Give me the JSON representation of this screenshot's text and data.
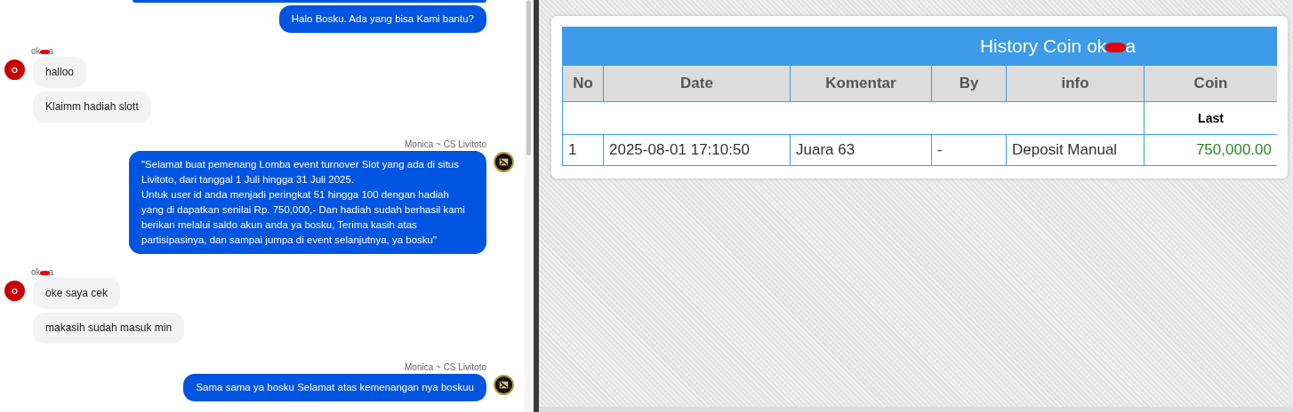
{
  "chat": {
    "groups": [
      {
        "kind": "agent",
        "avatar": false,
        "bubbles": [
          "Halo Bosku. Ada yang bisa Kami bantu?"
        ]
      },
      {
        "kind": "user",
        "sender": {
          "start": "ok",
          "end": "a",
          "redacted": true
        },
        "avatar_letter": "O",
        "bubbles": [
          "halloo",
          "Klaimm hadiah slott"
        ]
      },
      {
        "kind": "agent",
        "sender": "Monica ~ CS Livitoto",
        "avatar": true,
        "bubbles": [
          "\"Selamat buat pemenang Lomba event turnover Slot yang ada di situs Livitoto, dari tanggal 1 Juli hingga 31 Juli 2025.\nUntuk user id anda menjadi peringkat 51 hingga 100 dengan hadiah yang di dapatkan senilai Rp. 750,000,- Dan hadiah sudah berhasil kami berikan melalui saldo akun anda ya bosku, Terima kasih atas partisipasinya, dan sampai jumpa di event selanjutnya, ya bosku\""
        ]
      },
      {
        "kind": "user",
        "sender": {
          "start": "ok",
          "end": "a",
          "redacted": true
        },
        "avatar_letter": "O",
        "bubbles": [
          "oke saya cek",
          "makasih sudah masuk min"
        ]
      },
      {
        "kind": "agent",
        "sender": "Monica ~ CS Livitoto",
        "avatar": true,
        "bubbles": [
          "Sama sama ya bosku Selamat atas kemenangan nya boskuu"
        ]
      }
    ]
  },
  "history": {
    "title": {
      "start": "History Coin ok",
      "end": "a",
      "redacted": true
    },
    "columns": [
      "No",
      "Date",
      "Komentar",
      "By",
      "info",
      "Coin"
    ],
    "subheader": {
      "coin": "Last"
    },
    "rows": [
      {
        "no": "1",
        "date": "2025-08-01 17:10:50",
        "komentar": "Juara 63",
        "by": "-",
        "info": "Deposit Manual",
        "coin": "750,000.00"
      }
    ]
  }
}
